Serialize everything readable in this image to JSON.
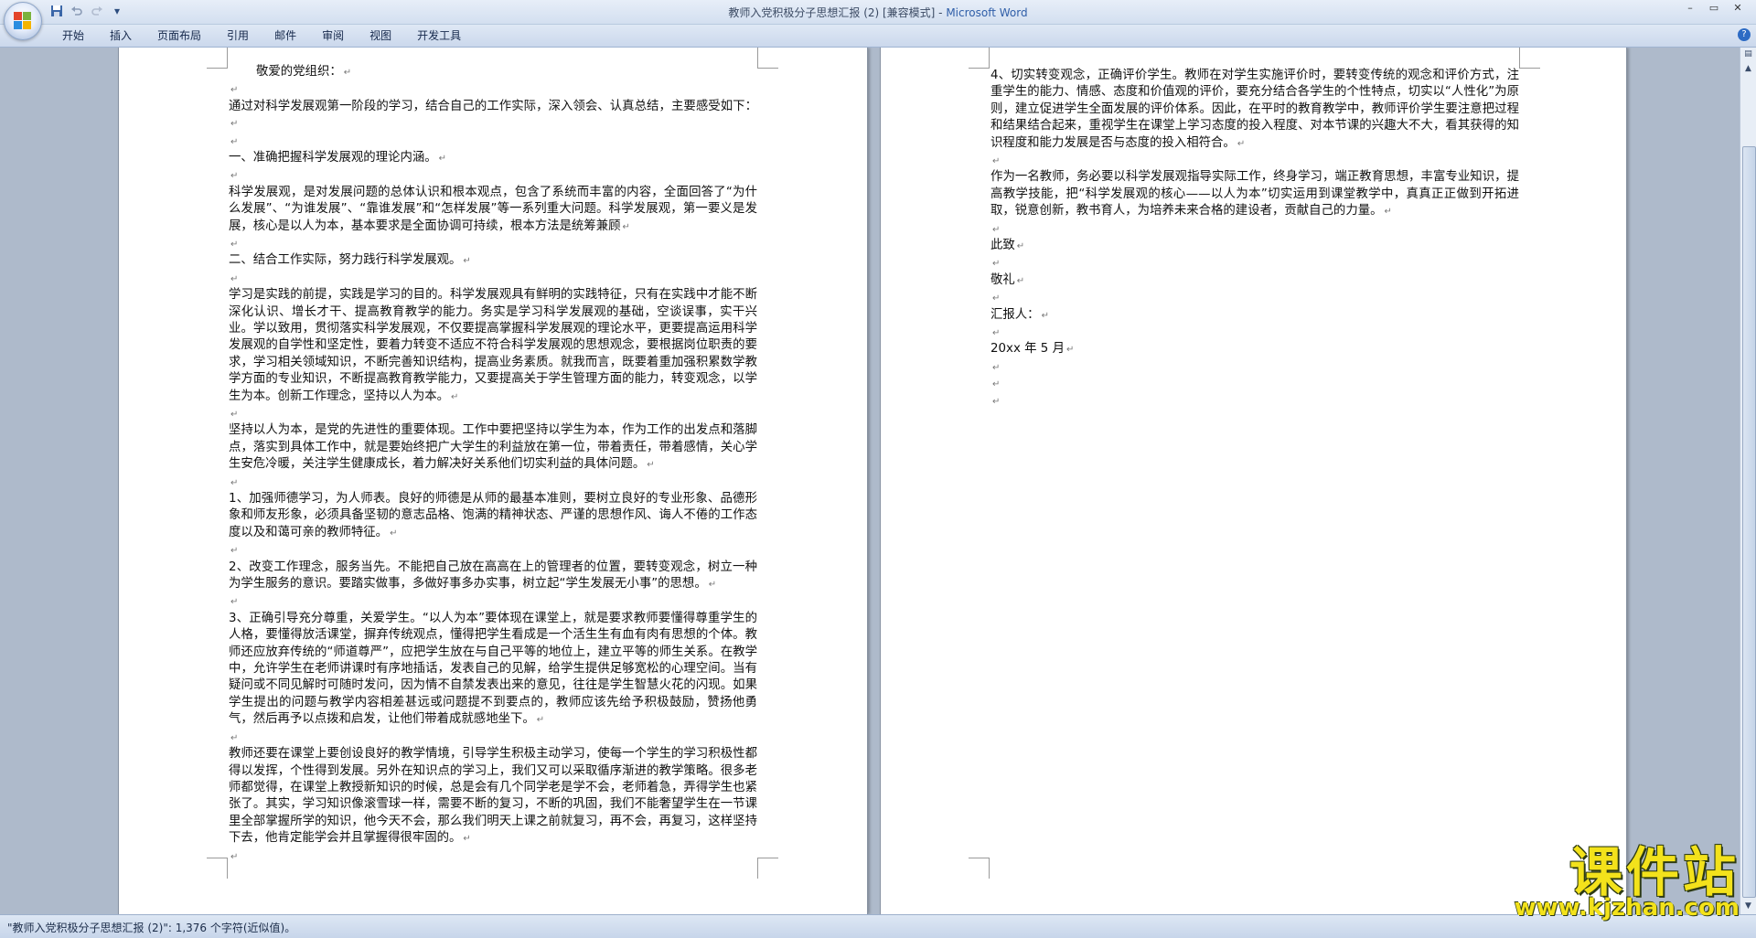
{
  "title_bar": {
    "doc_title": "教师入党积极分子思想汇报 (2) [兼容模式] - ",
    "app_name": "Microsoft Word",
    "qat": {
      "save_icon": "save-icon",
      "undo_icon": "undo-icon",
      "redo_icon": "redo-icon",
      "more": "▾"
    },
    "window_controls": {
      "minimize": "–",
      "restore": "▭",
      "close": "✕"
    }
  },
  "ribbon": {
    "tabs": [
      "开始",
      "插入",
      "页面布局",
      "引用",
      "邮件",
      "审阅",
      "视图",
      "开发工具"
    ],
    "help": "?"
  },
  "page1": {
    "paras": [
      "敬爱的党组织：",
      "",
      "通过对科学发展观第一阶段的学习，结合自己的工作实际，深入领会、认真总结，主要感受如下：",
      "",
      "一、准确把握科学发展观的理论内涵。",
      "",
      "科学发展观，是对发展问题的总体认识和根本观点，包含了系统而丰富的内容，全面回答了“为什么发展”、“为谁发展”、“靠谁发展”和“怎样发展”等一系列重大问题。科学发展观，第一要义是发展，核心是以人为本，基本要求是全面协调可持续，根本方法是统筹兼顾",
      "",
      "二、结合工作实际，努力践行科学发展观。",
      "",
      "学习是实践的前提，实践是学习的目的。科学发展观具有鲜明的实践特征，只有在实践中才能不断深化认识、增长才干、提高教育教学的能力。务实是学习科学发展观的基础，空谈误事，实干兴业。学以致用，贯彻落实科学发展观，不仅要提高掌握科学发展观的理论水平，更要提高运用科学发展观的自学性和坚定性，要着力转变不适应不符合科学发展观的思想观念，要根据岗位职责的要求，学习相关领域知识，不断完善知识结构，提高业务素质。就我而言，既要着重加强积累数学教学方面的专业知识，不断提高教育教学能力，又要提高关于学生管理方面的能力，转变观念，以学生为本。创新工作理念，坚持以人为本。",
      "",
      "坚持以人为本，是党的先进性的重要体现。工作中要把坚持以学生为本，作为工作的出发点和落脚点，落实到具体工作中，就是要始终把广大学生的利益放在第一位，带着责任，带着感情，关心学生安危冷暖，关注学生健康成长，着力解决好关系他们切实利益的具体问题。",
      "",
      "1、加强师德学习，为人师表。良好的师德是从师的最基本准则，要树立良好的专业形象、品德形象和师友形象，必须具备坚韧的意志品格、饱满的精神状态、严谨的思想作风、诲人不倦的工作态度以及和蔼可亲的教师特征。",
      "",
      "2、改变工作理念，服务当先。不能把自己放在高高在上的管理者的位置，要转变观念，树立一种为学生服务的意识。要踏实做事，多做好事多办实事，树立起“学生发展无小事”的思想。",
      "",
      "3、正确引导充分尊重，关爱学生。“以人为本”要体现在课堂上，就是要求教师要懂得尊重学生的人格，要懂得放活课堂，摒弃传统观点，懂得把学生看成是一个活生生有血有肉有思想的个体。教师还应放弃传统的“师道尊严”，应把学生放在与自己平等的地位上，建立平等的师生关系。在教学中，允许学生在老师讲课时有序地插话，发表自己的见解，给学生提供足够宽松的心理空间。当有疑问或不同见解时可随时发问，因为情不自禁发表出来的意见，往往是学生智慧火花的闪现。如果学生提出的问题与教学内容相差甚远或问题提不到要点的，教师应该先给予积极鼓励，赞扬他勇气，然后再予以点拨和启发，让他们带着成就感地坐下。",
      "",
      "教师还要在课堂上要创设良好的教学情境，引导学生积极主动学习，使每一个学生的学习积极性都得以发挥，个性得到发展。另外在知识点的学习上，我们又可以采取循序渐进的教学策略。很多老师都觉得，在课堂上教授新知识的时候，总是会有几个同学老是学不会，老师着急，弄得学生也紧张了。其实，学习知识像滚雪球一样，需要不断的复习，不断的巩固，我们不能奢望学生在一节课里全部掌握所学的知识，他今天不会，那么我们明天上课之前就复习，再不会，再复习，这样坚持下去，他肯定能学会并且掌握得很牢固的。",
      ""
    ]
  },
  "page2": {
    "paras": [
      "4、切实转变观念，正确评价学生。教师在对学生实施评价时，要转变传统的观念和评价方式，注重学生的能力、情感、态度和价值观的评价，要充分结合各学生的个性特点，切实以“人性化”为原则，建立促进学生全面发展的评价体系。因此，在平时的教育教学中，教师评价学生要注意把过程和结果结合起来，重视学生在课堂上学习态度的投入程度、对本节课的兴趣大不大，看其获得的知识程度和能力发展是否与态度的投入相符合。",
      "",
      "作为一名教师，务必要以科学发展观指导实际工作，终身学习，端正教育思想，丰富专业知识，提高教学技能，把“科学发展观的核心——以人为本”切实运用到课堂教学中，真真正正做到开拓进取，锐意创新，教书育人，为培养未来合格的建设者，贡献自己的力量。",
      "",
      "此致",
      "",
      "敬礼",
      "",
      "汇报人：",
      "",
      "20xx 年 5 月",
      "",
      "",
      ""
    ]
  },
  "status_bar": {
    "text": "\"教师入党积极分子思想汇报 (2)\": 1,376 个字符(近似值)。"
  },
  "watermark": {
    "title": "课件站",
    "url": "www.kjzhan.com"
  },
  "colors": {
    "app_name": "#2f5ea8",
    "background": "#aebacb",
    "watermark": "#f3e21b"
  }
}
